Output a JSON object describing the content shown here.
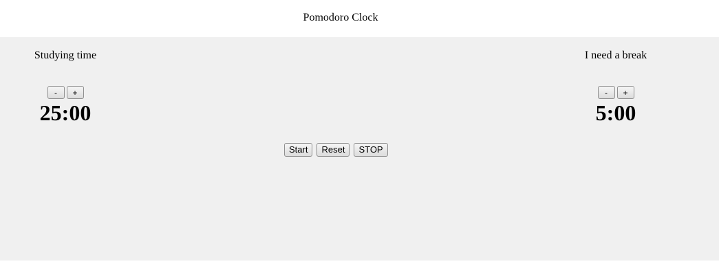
{
  "header": {
    "title": "Pomodoro Clock"
  },
  "study": {
    "label": "Studying time",
    "decrement": "-",
    "increment": "+",
    "time": "25:00"
  },
  "break": {
    "label": "I need a break",
    "decrement": "-",
    "increment": "+",
    "time": "5:00"
  },
  "controls": {
    "start": "Start",
    "reset": "Reset",
    "stop": "STOP"
  }
}
